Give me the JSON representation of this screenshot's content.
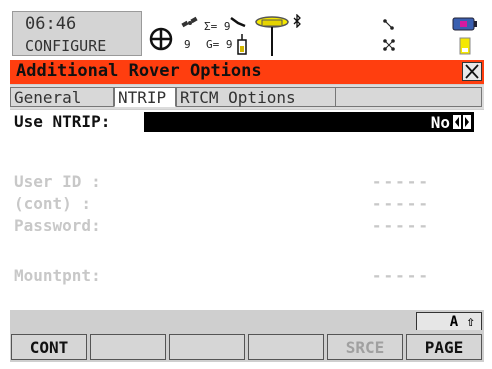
{
  "status": {
    "time": "06:46",
    "mode": "CONFIGURE",
    "sats_tracked": "9",
    "sigma": "Σ= 9",
    "glonass": "G= 9"
  },
  "window": {
    "title": "Additional Rover Options"
  },
  "tabs": [
    {
      "label": "General",
      "active": false
    },
    {
      "label": "NTRIP",
      "active": true
    },
    {
      "label": "RTCM Options",
      "active": false
    }
  ],
  "fields": {
    "use_ntrip": {
      "label": "Use NTRIP:",
      "value": "No"
    },
    "user_id": {
      "label": "User ID :",
      "value": "-----"
    },
    "cont": {
      "label": "(cont)  :",
      "value": "-----"
    },
    "password": {
      "label": "Password:",
      "value": "-----"
    },
    "mountpnt": {
      "label": "Mountpnt:",
      "value": "-----"
    }
  },
  "shift": {
    "label": "A ⇧"
  },
  "fkeys": [
    {
      "label": "CONT",
      "enabled": true
    },
    {
      "label": "",
      "enabled": false
    },
    {
      "label": "",
      "enabled": false
    },
    {
      "label": "",
      "enabled": false
    },
    {
      "label": "SRCE",
      "enabled": false
    },
    {
      "label": "PAGE",
      "enabled": true
    }
  ],
  "colors": {
    "title_bar": "#ff3e0f",
    "selection": "#000000",
    "disabled_text": "#c8c8c8"
  }
}
